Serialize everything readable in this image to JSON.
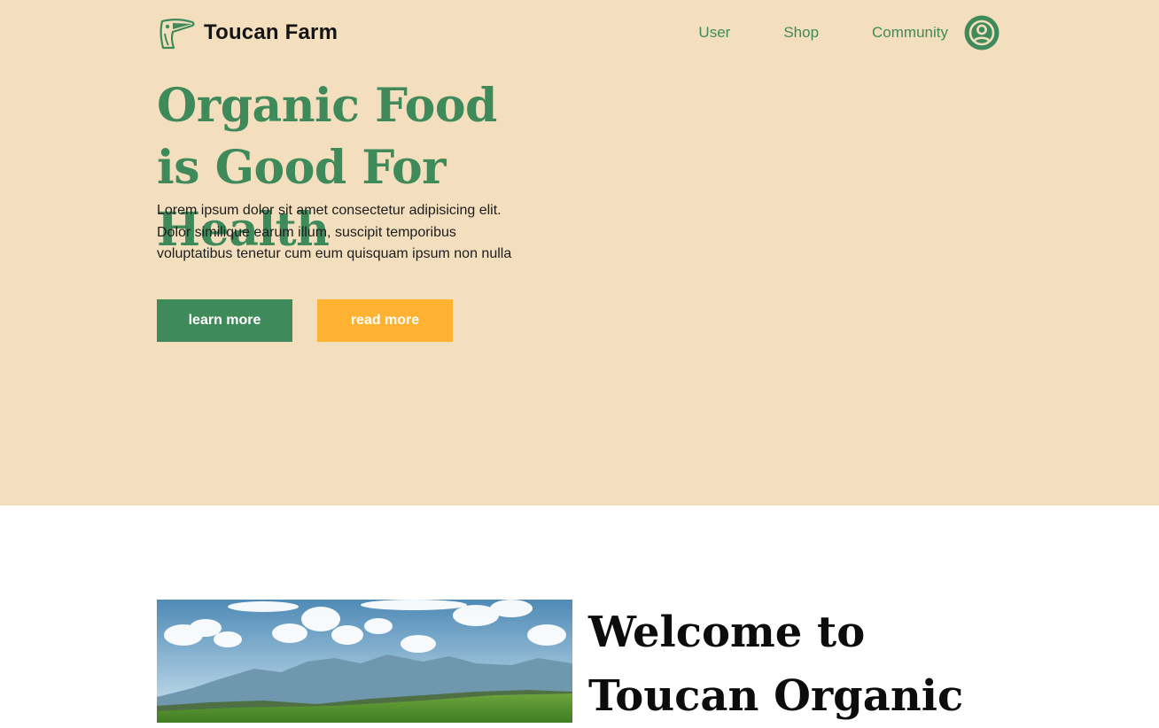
{
  "header": {
    "brand_name": "Toucan Farm",
    "logo_icon": "toucan-logo-icon",
    "nav": [
      "User",
      "Shop",
      "Community"
    ],
    "profile_icon": "user-circle-icon"
  },
  "hero": {
    "title": "Organic Food is Good For Health",
    "description": "Lorem ipsum dolor sit amet consectetur adipisicing elit. Dolor similique earum illum, suscipit temporibus voluptatibus tenetur cum eum quisquam ipsum non nulla",
    "learn_more_label": "learn more",
    "read_more_label": "read more"
  },
  "about": {
    "image_icon": "landscape-image",
    "title": "Welcome to Toucan Organic"
  },
  "colors": {
    "hero_background": "#f3dfbd",
    "brand_green": "#3f8a5b",
    "accent_orange": "#fdb232"
  }
}
